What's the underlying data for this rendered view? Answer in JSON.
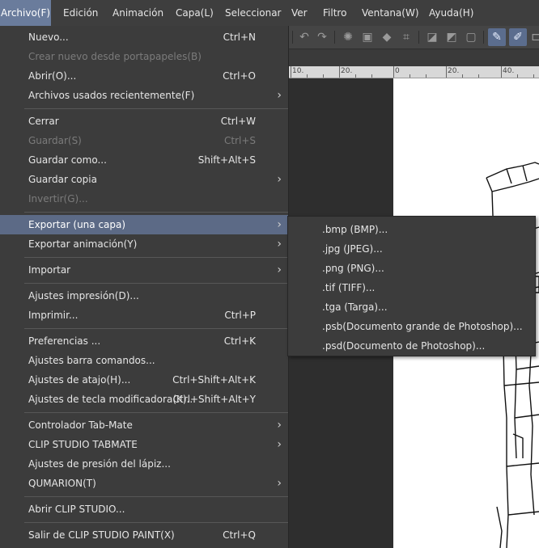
{
  "menubar": {
    "items": [
      "Archivo(F)",
      "Edición",
      "Animación",
      "Capa(L)",
      "Seleccionar",
      "Ver",
      "Filtro",
      "Ventana(W)",
      "Ayuda(H)"
    ]
  },
  "ruler": {
    "labels": [
      "10.",
      "20.",
      "0",
      "20.",
      "40."
    ]
  },
  "file_menu": {
    "items": [
      {
        "label": "Nuevo...",
        "shortcut": "Ctrl+N",
        "disabled": false,
        "submenu": false
      },
      {
        "label": "Crear nuevo desde portapapeles(B)",
        "shortcut": "",
        "disabled": true,
        "submenu": false
      },
      {
        "label": "Abrir(O)...",
        "shortcut": "Ctrl+O",
        "disabled": false,
        "submenu": false
      },
      {
        "label": "Archivos usados recientemente(F)",
        "shortcut": "",
        "disabled": false,
        "submenu": true
      },
      {
        "label": "Cerrar",
        "shortcut": "Ctrl+W",
        "disabled": false,
        "submenu": false
      },
      {
        "label": "Guardar(S)",
        "shortcut": "Ctrl+S",
        "disabled": true,
        "submenu": false
      },
      {
        "label": "Guardar como...",
        "shortcut": "Shift+Alt+S",
        "disabled": false,
        "submenu": false
      },
      {
        "label": "Guardar copia",
        "shortcut": "",
        "disabled": false,
        "submenu": true
      },
      {
        "label": "Invertir(G)...",
        "shortcut": "",
        "disabled": true,
        "submenu": false
      },
      {
        "label": "Exportar (una capa)",
        "shortcut": "",
        "disabled": false,
        "submenu": true
      },
      {
        "label": "Exportar animación(Y)",
        "shortcut": "",
        "disabled": false,
        "submenu": true
      },
      {
        "label": "Importar",
        "shortcut": "",
        "disabled": false,
        "submenu": true
      },
      {
        "label": "Ajustes impresión(D)...",
        "shortcut": "",
        "disabled": false,
        "submenu": false
      },
      {
        "label": "Imprimir...",
        "shortcut": "Ctrl+P",
        "disabled": false,
        "submenu": false
      },
      {
        "label": "Preferencias ...",
        "shortcut": "Ctrl+K",
        "disabled": false,
        "submenu": false
      },
      {
        "label": "Ajustes barra comandos...",
        "shortcut": "",
        "disabled": false,
        "submenu": false
      },
      {
        "label": "Ajustes de atajo(H)...",
        "shortcut": "Ctrl+Shift+Alt+K",
        "disabled": false,
        "submenu": false
      },
      {
        "label": "Ajustes de tecla modificadora(K)...",
        "shortcut": "Ctrl+Shift+Alt+Y",
        "disabled": false,
        "submenu": false
      },
      {
        "label": "Controlador Tab-Mate",
        "shortcut": "",
        "disabled": false,
        "submenu": true
      },
      {
        "label": "CLIP STUDIO TABMATE",
        "shortcut": "",
        "disabled": false,
        "submenu": true
      },
      {
        "label": "Ajustes de presión del lápiz...",
        "shortcut": "",
        "disabled": false,
        "submenu": false
      },
      {
        "label": "QUMARION(T)",
        "shortcut": "",
        "disabled": false,
        "submenu": true
      },
      {
        "label": "Abrir CLIP STUDIO...",
        "shortcut": "",
        "disabled": false,
        "submenu": false
      },
      {
        "label": "Salir de CLIP STUDIO PAINT(X)",
        "shortcut": "Ctrl+Q",
        "disabled": false,
        "submenu": false
      }
    ]
  },
  "export_submenu": {
    "items": [
      ".bmp (BMP)...",
      ".jpg (JPEG)...",
      ".png (PNG)...",
      ".tif (TIFF)...",
      ".tga (Targa)...",
      ".psb(Documento grande de Photoshop)...",
      ".psd(Documento de Photoshop)..."
    ]
  },
  "colors": {
    "menu_bg": "#3c3c3c",
    "highlight": "#5c6a86",
    "disabled_text": "#7b7b7b"
  }
}
